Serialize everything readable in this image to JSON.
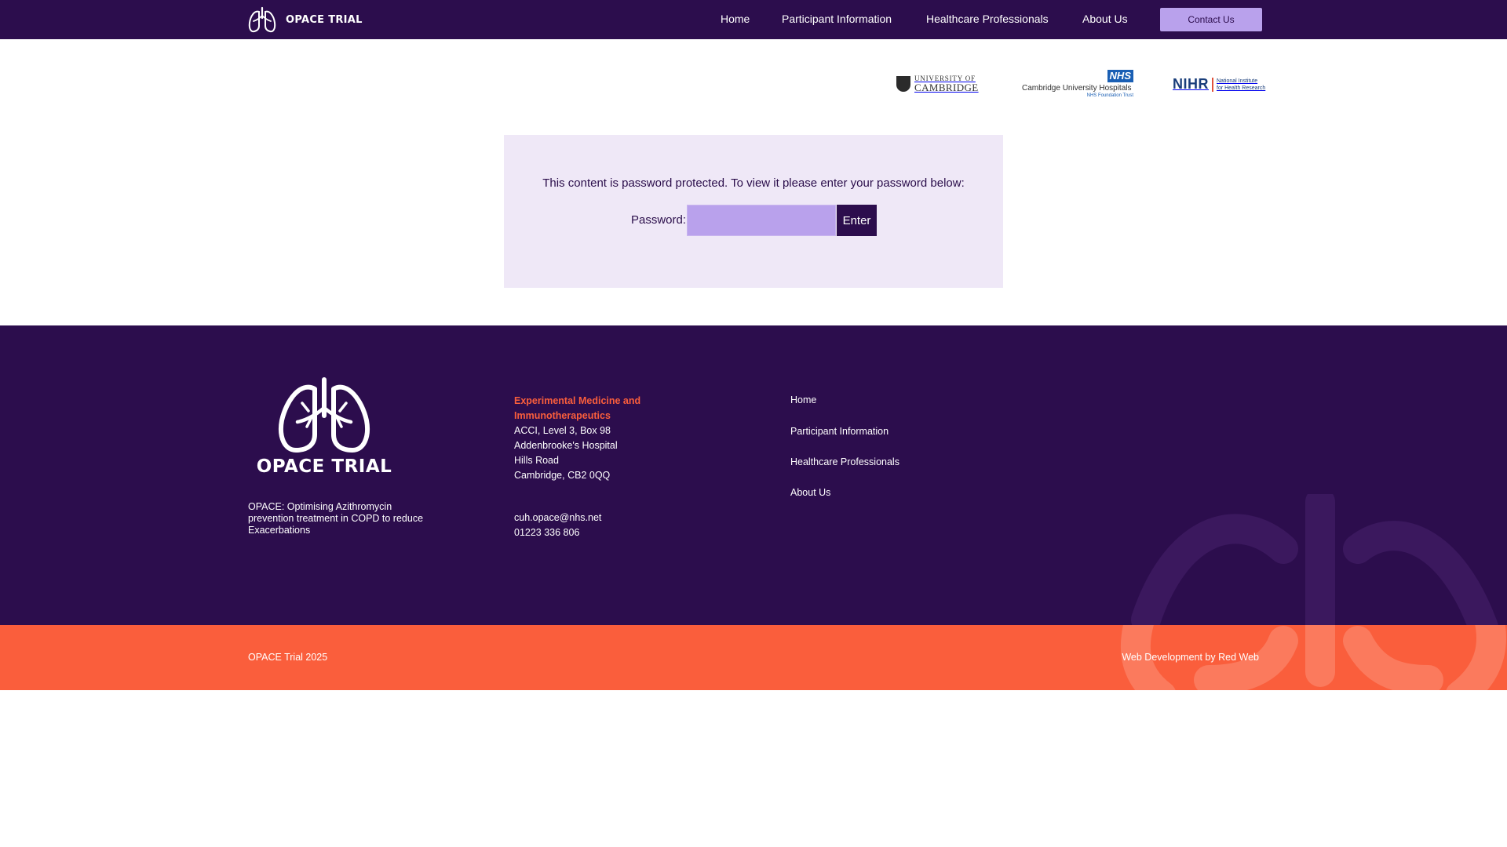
{
  "header": {
    "brand": "OPACE TRIAL",
    "nav": [
      "Home",
      "Participant Information",
      "Healthcare Professionals",
      "About Us"
    ],
    "contact_button": "Contact Us"
  },
  "partners": {
    "cambridge": {
      "line1": "UNIVERSITY OF",
      "line2": "CAMBRIDGE"
    },
    "cuh": {
      "badge": "NHS",
      "name": "Cambridge University Hospitals",
      "sub": "NHS Foundation Trust"
    },
    "nihr": {
      "mark": "NIHR",
      "line1": "National Institute",
      "line2": "for Health Research"
    }
  },
  "password_form": {
    "message": "This content is password protected. To view it please enter your password below:",
    "label": "Password:",
    "value": "",
    "submit_label": "Enter"
  },
  "footer": {
    "logo_text": "OPACE TRIAL",
    "description": "OPACE: Optimising Azithromycin prevention treatment in COPD to reduce Exacerbations",
    "address": {
      "department": "Experimental Medicine and Immunotherapeutics",
      "lines": [
        "ACCI, Level 3, Box 98",
        "Addenbrooke's Hospital",
        "Hills Road",
        "Cambridge, CB2 0QQ"
      ]
    },
    "email": "cuh.opace@nhs.net",
    "phone": "01223 336 806",
    "nav": [
      "Home",
      "Participant Information",
      "Healthcare Professionals",
      "About Us"
    ]
  },
  "bottom_bar": {
    "copyright": "OPACE Trial 2025",
    "credit": "Web Development by Red Web"
  },
  "colors": {
    "brand_purple": "#2c0d4d",
    "light_lavender": "#efe8f7",
    "accent_lavender": "#b9a1ec",
    "accent_orange": "#fa5e3c"
  }
}
